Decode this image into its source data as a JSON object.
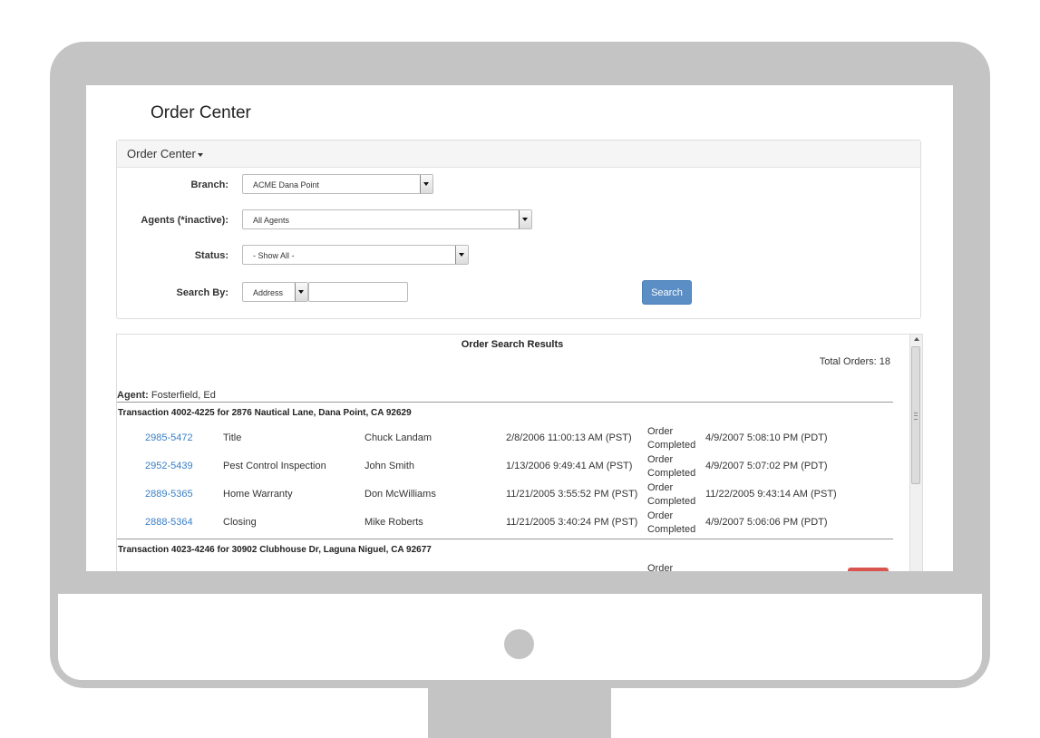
{
  "page": {
    "title": "Order Center"
  },
  "panel": {
    "header": "Order Center",
    "branch": {
      "label": "Branch:",
      "value": "ACME Dana Point"
    },
    "agents": {
      "label": "Agents (*inactive):",
      "value": "All Agents"
    },
    "status": {
      "label": "Status:",
      "value": "- Show All -"
    },
    "search_by": {
      "label": "Search By:",
      "value": "Address",
      "text": ""
    },
    "search_button": "Search"
  },
  "results": {
    "title": "Order Search Results",
    "total": "Total Orders: 18",
    "agent_label": "Agent:",
    "agent_name": "Fosterfield, Ed",
    "transactions": [
      {
        "header": "Transaction 4002-4225 for 2876 Nautical Lane, Dana Point, CA 92629",
        "orders": [
          {
            "id": "2985-5472",
            "type": "Title",
            "name": "Chuck Landam",
            "date": "2/8/2006 11:00:13 AM (PST)",
            "status_1": "Order",
            "status_2": "Completed",
            "completed": "4/9/2007 5:08:10 PM (PDT)"
          },
          {
            "id": "2952-5439",
            "type": "Pest Control Inspection",
            "name": "John Smith",
            "date": "1/13/2006 9:49:41 AM (PST)",
            "status_1": "Order",
            "status_2": "Completed",
            "completed": "4/9/2007 5:07:02 PM (PDT)"
          },
          {
            "id": "2889-5365",
            "type": "Home Warranty",
            "name": "Don McWilliams",
            "date": "11/21/2005 3:55:52 PM (PST)",
            "status_1": "Order",
            "status_2": "Completed",
            "completed": "11/22/2005 9:43:14 AM (PST)"
          },
          {
            "id": "2888-5364",
            "type": "Closing",
            "name": "Mike Roberts",
            "date": "11/21/2005 3:40:24 PM (PST)",
            "status_1": "Order",
            "status_2": "Completed",
            "completed": "4/9/2007 5:06:06 PM (PDT)"
          }
        ]
      },
      {
        "header": "Transaction 4023-4246 for 30902 Clubhouse Dr, Laguna Niguel, CA 92677",
        "partial_status": "Order"
      }
    ]
  },
  "colors": {
    "link": "#3a7fc4",
    "primary_button": "#5b8ec5",
    "danger_button": "#d9534f",
    "frame": "#c4c4c4"
  }
}
